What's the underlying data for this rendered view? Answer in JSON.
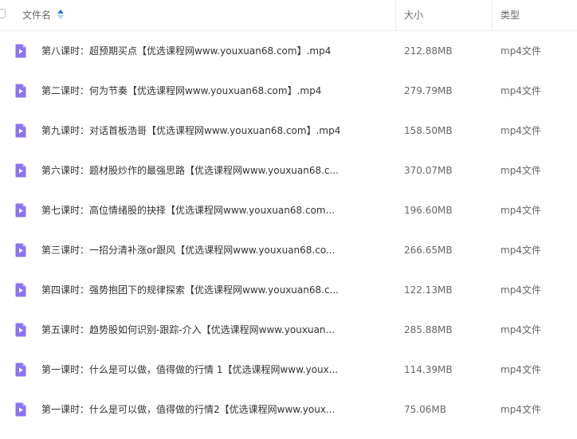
{
  "header": {
    "name": "文件名",
    "size": "大小",
    "type": "类型"
  },
  "accent_color": "#1a7cf5",
  "file_icon_color": "#8b73f2",
  "files": [
    {
      "name": "第八课时：超预期买点【优选课程网www.youxuan68.com】.mp4",
      "size": "212.88MB",
      "type": "mp4文件"
    },
    {
      "name": "第二课时：何为节奏【优选课程网www.youxuan68.com】.mp4",
      "size": "279.79MB",
      "type": "mp4文件"
    },
    {
      "name": "第九课时：对话首板浩哥【优选课程网www.youxuan68.com】.mp4",
      "size": "158.50MB",
      "type": "mp4文件"
    },
    {
      "name": "第六课时：题材股炒作的最强思路【优选课程网www.youxuan68.c...",
      "size": "370.07MB",
      "type": "mp4文件"
    },
    {
      "name": "第七课时：高位情绪股的抉择【优选课程网www.youxuan68.com...",
      "size": "196.60MB",
      "type": "mp4文件"
    },
    {
      "name": "第三课时：一招分清补涨or跟风【优选课程网www.youxuan68.co...",
      "size": "266.65MB",
      "type": "mp4文件"
    },
    {
      "name": "第四课时：强势抱团下的规律探索【优选课程网www.youxuan68.c...",
      "size": "122.13MB",
      "type": "mp4文件"
    },
    {
      "name": "第五课时：趋势股如何识别-跟踪-介入【优选课程网www.youxuan...",
      "size": "285.88MB",
      "type": "mp4文件"
    },
    {
      "name": "第一课时：什么是可以做，值得做的行情 1【优选课程网www.youx...",
      "size": "114.39MB",
      "type": "mp4文件"
    },
    {
      "name": "第一课时：什么是可以做，值得做的行情2【优选课程网www.youx...",
      "size": "75.06MB",
      "type": "mp4文件"
    }
  ]
}
